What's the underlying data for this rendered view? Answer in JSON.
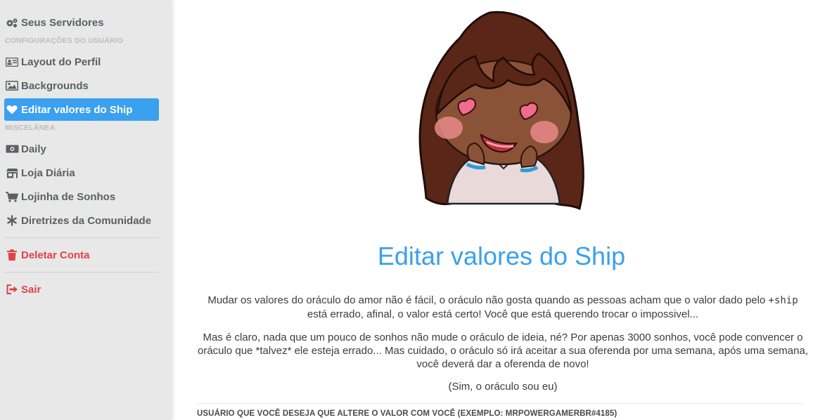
{
  "sidebar": {
    "items": [
      {
        "label": "Seus Servidores",
        "icon": "gears-icon"
      },
      {
        "label": "Layout do Perfil",
        "icon": "id-card-icon"
      },
      {
        "label": "Backgrounds",
        "icon": "image-icon"
      },
      {
        "label": "Editar valores do Ship",
        "icon": "heart-icon",
        "active": true
      },
      {
        "label": "Daily",
        "icon": "money-icon"
      },
      {
        "label": "Loja Diária",
        "icon": "store-icon"
      },
      {
        "label": "Lojinha de Sonhos",
        "icon": "cart-icon"
      },
      {
        "label": "Diretrizes da Comunidade",
        "icon": "asterisk-icon"
      },
      {
        "label": "Deletar Conta",
        "icon": "trash-icon",
        "danger": true
      },
      {
        "label": "Sair",
        "icon": "sign-out-icon",
        "danger": true
      }
    ],
    "headers": {
      "user_settings": "CONFIGURAÇÕES DO USUÁRIO",
      "misc": "MISCELÂNEA"
    }
  },
  "main": {
    "title": "Editar valores do Ship",
    "para1_before": "Mudar os valores do oráculo do amor não é fácil, o oráculo não gosta quando as pessoas acham que o valor dado pelo ",
    "para1_code": "+ship",
    "para1_after": " está errado, afinal, o valor está certo! Você que está querendo trocar o impossivel...",
    "para2": "Mas é claro, nada que um pouco de sonhos não mude o oráculo de ideia, né? Por apenas 3000 sonhos, você pode convencer o oráculo que *talvez* ele esteja errado... Mas cuidado, o oráculo só irá aceitar a sua oferenda por uma semana, após uma semana, você deverá dar a oferenda de novo!",
    "para3": "(Sim, o oráculo sou eu)",
    "form_label": "USUÁRIO QUE VOCÊ DESEJA QUE ALTERE O VALOR COM VOCÊ (EXEMPLO: MRPOWERGAMERBR#4185)"
  },
  "colors": {
    "accent": "#3aa0ef",
    "danger": "#e0424a",
    "sidebar_bg": "#e8e8e8",
    "sidebar_text": "#5b5f66"
  }
}
